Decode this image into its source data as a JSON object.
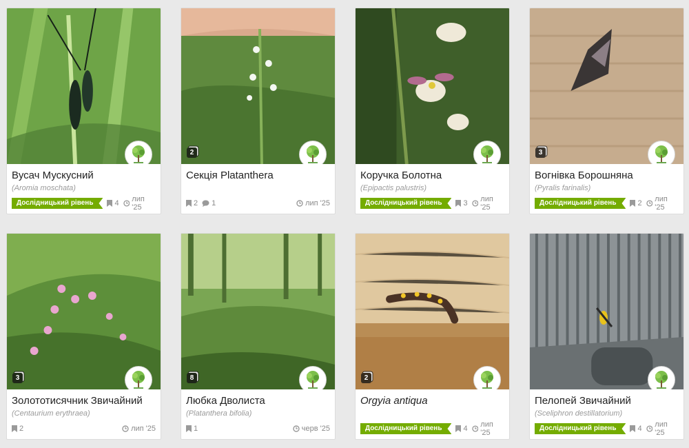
{
  "cards": [
    {
      "title": "Вусач Мускусний",
      "sci": "(Aromia moschata)",
      "research": true,
      "photo_count": "",
      "ids": "4",
      "comments": "",
      "date": "лип '25"
    },
    {
      "title": "Секція Platanthera",
      "sci": "",
      "research": false,
      "photo_count": "2",
      "ids": "2",
      "comments": "1",
      "date": "лип '25"
    },
    {
      "title": "Коручка Болотна",
      "sci": "(Epipactis palustris)",
      "research": true,
      "photo_count": "",
      "ids": "3",
      "comments": "",
      "date": "лип '25"
    },
    {
      "title": "Вогнівка Борошняна",
      "sci": "(Pyralis farinalis)",
      "research": true,
      "photo_count": "3",
      "ids": "2",
      "comments": "",
      "date": "лип '25"
    },
    {
      "title": "Золототисячник Звичайний",
      "sci": "(Centaurium erythraea)",
      "research": false,
      "photo_count": "3",
      "ids": "2",
      "comments": "",
      "date": "лип '25"
    },
    {
      "title": "Любка Дволиста",
      "sci": "(Platanthera bifolia)",
      "research": false,
      "photo_count": "8",
      "ids": "1",
      "comments": "",
      "date": "черв '25"
    },
    {
      "title": "Orgyia antiqua",
      "sci": "",
      "research": true,
      "photo_count": "2",
      "ids": "4",
      "comments": "",
      "date": "лип '25"
    },
    {
      "title": "Пелопей Звичайний",
      "sci": "(Sceliphron destillatorium)",
      "research": true,
      "photo_count": "",
      "ids": "4",
      "comments": "",
      "date": "лип '25"
    }
  ],
  "badge_label": "Дослідницький рівень",
  "colors": {
    "research_badge": "#74ac00",
    "avatar_tree": "#6aa84f"
  },
  "icons": {
    "ids": "identification-icon",
    "comments": "comment-icon",
    "date": "clock-icon",
    "avatar": "tree-avatar-icon"
  }
}
